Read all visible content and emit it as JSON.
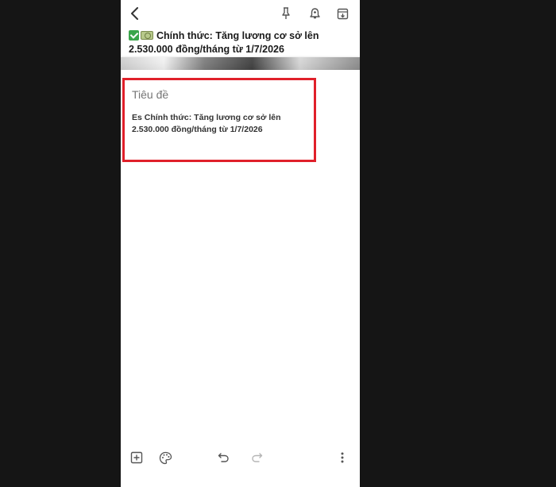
{
  "note": {
    "preview_title": "Chính thức: Tăng lương cơ sở lên 2.530.000 đồng/tháng từ 1/7/2026",
    "title_placeholder": "Tiêu đề",
    "body": "Es Chính thức: Tăng lương cơ sở lên 2.530.000 đồng/tháng từ 1/7/2026"
  },
  "toolbar_top": {
    "icons": [
      "back-arrow-icon",
      "pin-icon",
      "reminder-bell-icon",
      "archive-icon"
    ]
  },
  "toolbar_bottom": {
    "icons": [
      "add-box-icon",
      "palette-icon",
      "undo-icon",
      "redo-icon",
      "more-vert-icon"
    ]
  },
  "colors": {
    "highlight_border": "#e0202a",
    "checkmark": "#3aa54a",
    "background": "#151515"
  }
}
